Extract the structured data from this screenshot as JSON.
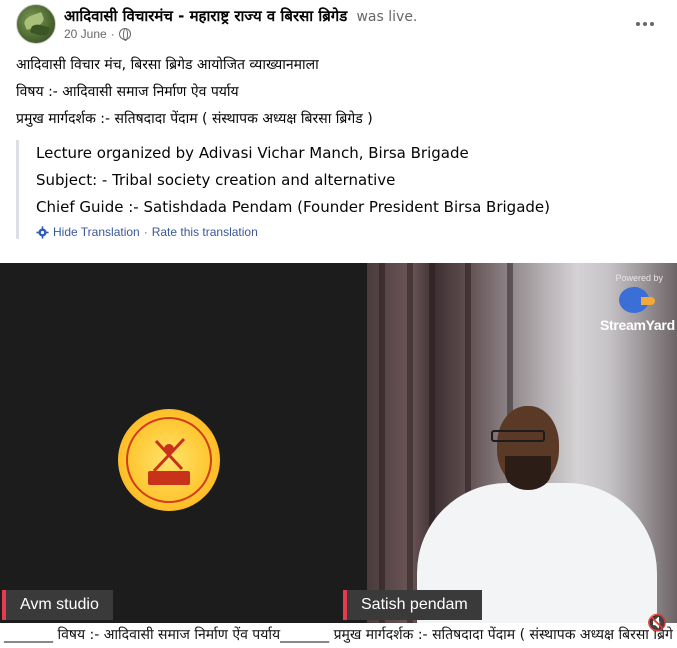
{
  "header": {
    "page_name": "आदिवासी विचारमंच - महाराष्ट्र राज्य व बिरसा ब्रिगेड",
    "status": "was live.",
    "date": "20 June",
    "separator": "·"
  },
  "post": {
    "lines": [
      "आदिवासी विचार मंच, बिरसा ब्रिगेड आयोजित व्याख्यानमाला",
      "विषय :- आदिवासी समाज निर्माण ऐव पर्याय",
      "प्रमुख मार्गदर्शक :- सतिषदादा पेंदाम ( संस्थापक अध्यक्ष बिरसा ब्रिगेड )"
    ]
  },
  "translation": {
    "lines": [
      "Lecture organized by Adivasi Vichar Manch, Birsa Brigade",
      "Subject: - Tribal society creation and alternative",
      "Chief Guide :- Satishdada Pendam (Founder President Birsa Brigade)"
    ],
    "hide_label": "Hide Translation",
    "separator": "·",
    "rate_label": "Rate this translation"
  },
  "video": {
    "left_name": "Avm studio",
    "right_name": "Satish pendam",
    "watermark_powered": "Powered by",
    "watermark_brand": "StreamYard",
    "ticker": "_______ विषय :- आदिवासी समाज निर्माण ऐंव पर्याय_______ प्रमुख मार्गदर्शक :- सतिषदादा पेंदाम ( संस्थापक अध्यक्ष बिरसा ब्रिगे"
  },
  "colors": {
    "name_tag_accent": "#e43c4e",
    "link": "#385898",
    "meta": "#65676b"
  },
  "icons": {
    "globe": "globe-icon",
    "more": "more-options-icon",
    "gear": "gear-icon",
    "mute": "mute-icon"
  }
}
